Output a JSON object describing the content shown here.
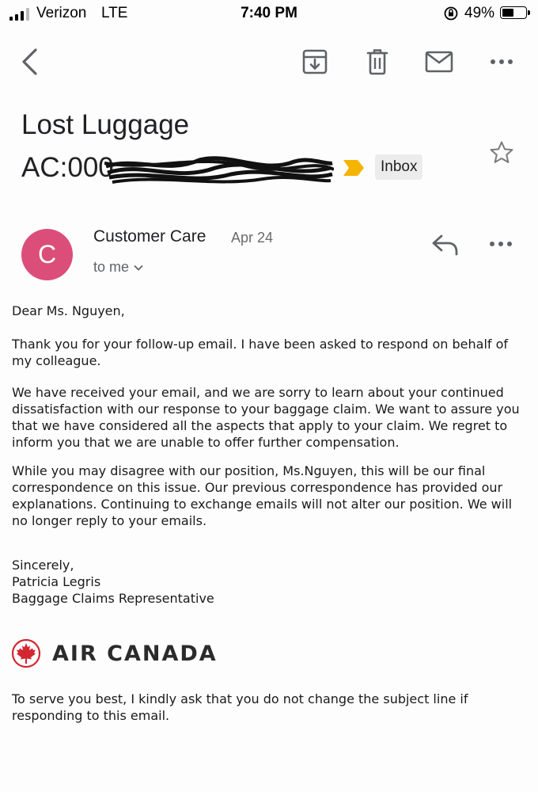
{
  "status_bar": {
    "carrier": "Verizon",
    "network": "LTE",
    "time": "7:40 PM",
    "battery": "49%"
  },
  "toolbar": {
    "back_icon": "back-arrow-icon",
    "archive_icon": "archive-icon",
    "delete_icon": "trash-icon",
    "mark_unread_icon": "mail-icon",
    "more_icon": "more-horizontal-icon"
  },
  "subject": {
    "line1": "Lost Luggage",
    "line2_prefix": "AC:",
    "label": "Inbox"
  },
  "sender": {
    "avatar_letter": "C",
    "avatar_color": "#dc4e7a",
    "name": "Customer Care",
    "date": "Apr 24",
    "recipient": "to me"
  },
  "body": {
    "greeting": "Dear Ms. Nguyen,",
    "p1": "Thank you for your follow-up email. I have been asked to respond on behalf of my colleague.",
    "p2": "We have received your email, and we are sorry to learn about your continued dissatisfaction with our response to your baggage claim. We want to assure you that we have considered all the aspects that apply to your claim. We regret to inform you that we are unable to offer further compensation.",
    "p3": "While you may disagree with our position, Ms.Nguyen, this will be our final correspondence on this issue. Our previous correspondence has provided our explanations. Continuing to exchange emails will not alter our position. We will no longer reply to your emails.",
    "closing": "Sincerely,",
    "signer": "Patricia Legris",
    "signer_title": "Baggage Claims Representative",
    "company": "AIR CANADA",
    "footer": "To serve you best, I kindly ask that you do not change the subject line if responding to this email."
  }
}
